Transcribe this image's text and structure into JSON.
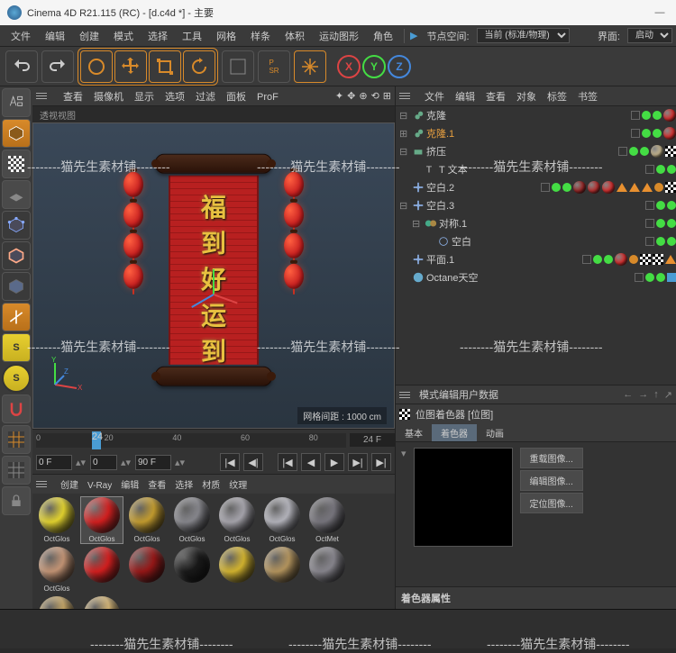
{
  "title": "Cinema 4D R21.115 (RC) - [d.c4d *] - 主要",
  "menu": [
    "文件",
    "编辑",
    "创建",
    "模式",
    "选择",
    "工具",
    "网格",
    "样条",
    "体积",
    "运动图形",
    "角色"
  ],
  "nodespace_label": "节点空间:",
  "nodespace_value": "当前 (标准/物理)",
  "interface_label": "界面:",
  "interface_value": "启动",
  "view_menu": [
    "查看",
    "摄像机",
    "显示",
    "选项",
    "过滤",
    "面板",
    "ProF"
  ],
  "view_tab": "透视视图",
  "scroll_chars": [
    "福",
    "到",
    "好",
    "运",
    "到"
  ],
  "grid_info": "网格间距 : 1000 cm",
  "timeline": {
    "ticks": [
      "0",
      "20",
      "40",
      "60",
      "80"
    ],
    "marker": "24",
    "total": "24 F"
  },
  "playback": {
    "start": "0 F",
    "mid": "0",
    "end": "90 F"
  },
  "mat_menu": [
    "创建",
    "V-Ray",
    "编辑",
    "查看",
    "选择",
    "材质",
    "纹理"
  ],
  "materials_row1": [
    {
      "c": "#e8d830",
      "l": "OctGlos"
    },
    {
      "c": "#d82020",
      "l": "OctGlos"
    },
    {
      "c": "#c8a030",
      "l": "OctGlos"
    },
    {
      "c": "#8a8a90",
      "l": "OctGlos"
    },
    {
      "c": "#aaa8b0",
      "l": "OctGlos"
    },
    {
      "c": "#b8b8c0",
      "l": "OctGlos"
    },
    {
      "c": "#7a7880",
      "l": "OctMet"
    },
    {
      "c": "#c89878",
      "l": "OctGlos"
    }
  ],
  "materials_row2": [
    {
      "c": "#d82020",
      "l": ""
    },
    {
      "c": "#9a1818",
      "l": ""
    },
    {
      "c": "#1a1a1a",
      "l": ""
    },
    {
      "c": "#d8b830",
      "l": ""
    },
    {
      "c": "#b89860",
      "l": ""
    },
    {
      "c": "#8a8890",
      "l": ""
    },
    {
      "c": "#c8a868",
      "l": ""
    },
    {
      "c": "#d8b878",
      "l": ""
    }
  ],
  "obj_menu": [
    "文件",
    "编辑",
    "查看",
    "对象",
    "标签",
    "书签"
  ],
  "tree": [
    {
      "d": 0,
      "exp": "⊟",
      "icon": "clone",
      "name": "克隆",
      "sel": false,
      "tags": [
        {
          "t": "ball",
          "c": "#d83030"
        }
      ]
    },
    {
      "d": 0,
      "exp": "⊞",
      "icon": "clone",
      "name": "克隆.1",
      "sel": true,
      "tags": [
        {
          "t": "ball",
          "c": "#d83030"
        }
      ]
    },
    {
      "d": 0,
      "exp": "⊟",
      "icon": "extrude",
      "name": "挤压",
      "sel": false,
      "tags": [
        {
          "t": "ball",
          "c": "#c8b890"
        },
        {
          "t": "cb"
        }
      ]
    },
    {
      "d": 1,
      "exp": "",
      "icon": "text",
      "name": "T 文本",
      "sel": false,
      "tags": []
    },
    {
      "d": 0,
      "exp": "",
      "icon": "null",
      "name": "空白.2",
      "sel": false,
      "tags": [
        {
          "t": "ball",
          "c": "#9a2828"
        },
        {
          "t": "ball",
          "c": "#b83030"
        },
        {
          "t": "ball",
          "c": "#d83030"
        },
        {
          "t": "tri"
        },
        {
          "t": "tri"
        },
        {
          "t": "tri"
        },
        {
          "t": "dot"
        },
        {
          "t": "cb"
        }
      ]
    },
    {
      "d": 0,
      "exp": "⊟",
      "icon": "null",
      "name": "空白.3",
      "sel": false,
      "tags": []
    },
    {
      "d": 1,
      "exp": "⊟",
      "icon": "sym",
      "name": "对称.1",
      "sel": false,
      "tags": []
    },
    {
      "d": 2,
      "exp": "",
      "icon": "null2",
      "name": "空白",
      "sel": false,
      "tags": []
    },
    {
      "d": 0,
      "exp": "",
      "icon": "null",
      "name": "平面.1",
      "sel": false,
      "tags": [
        {
          "t": "ball",
          "c": "#d83030"
        },
        {
          "t": "dot"
        },
        {
          "t": "cb"
        },
        {
          "t": "cb"
        },
        {
          "t": "tri"
        }
      ]
    },
    {
      "d": 0,
      "exp": "",
      "icon": "sky",
      "name": "Octane天空",
      "sel": false,
      "tags": [
        {
          "t": "sq"
        }
      ]
    }
  ],
  "attr_menu": [
    "模式",
    "编辑",
    "用户数据"
  ],
  "attr_title": "位图着色器 [位图]",
  "attr_tabs": [
    "基本",
    "着色器",
    "动画"
  ],
  "attr_active_tab": 1,
  "attr_btns": [
    "重载图像...",
    "编辑图像...",
    "定位图像..."
  ],
  "attr_section": "着色器属性",
  "watermark": "--------猫先生素材铺--------"
}
